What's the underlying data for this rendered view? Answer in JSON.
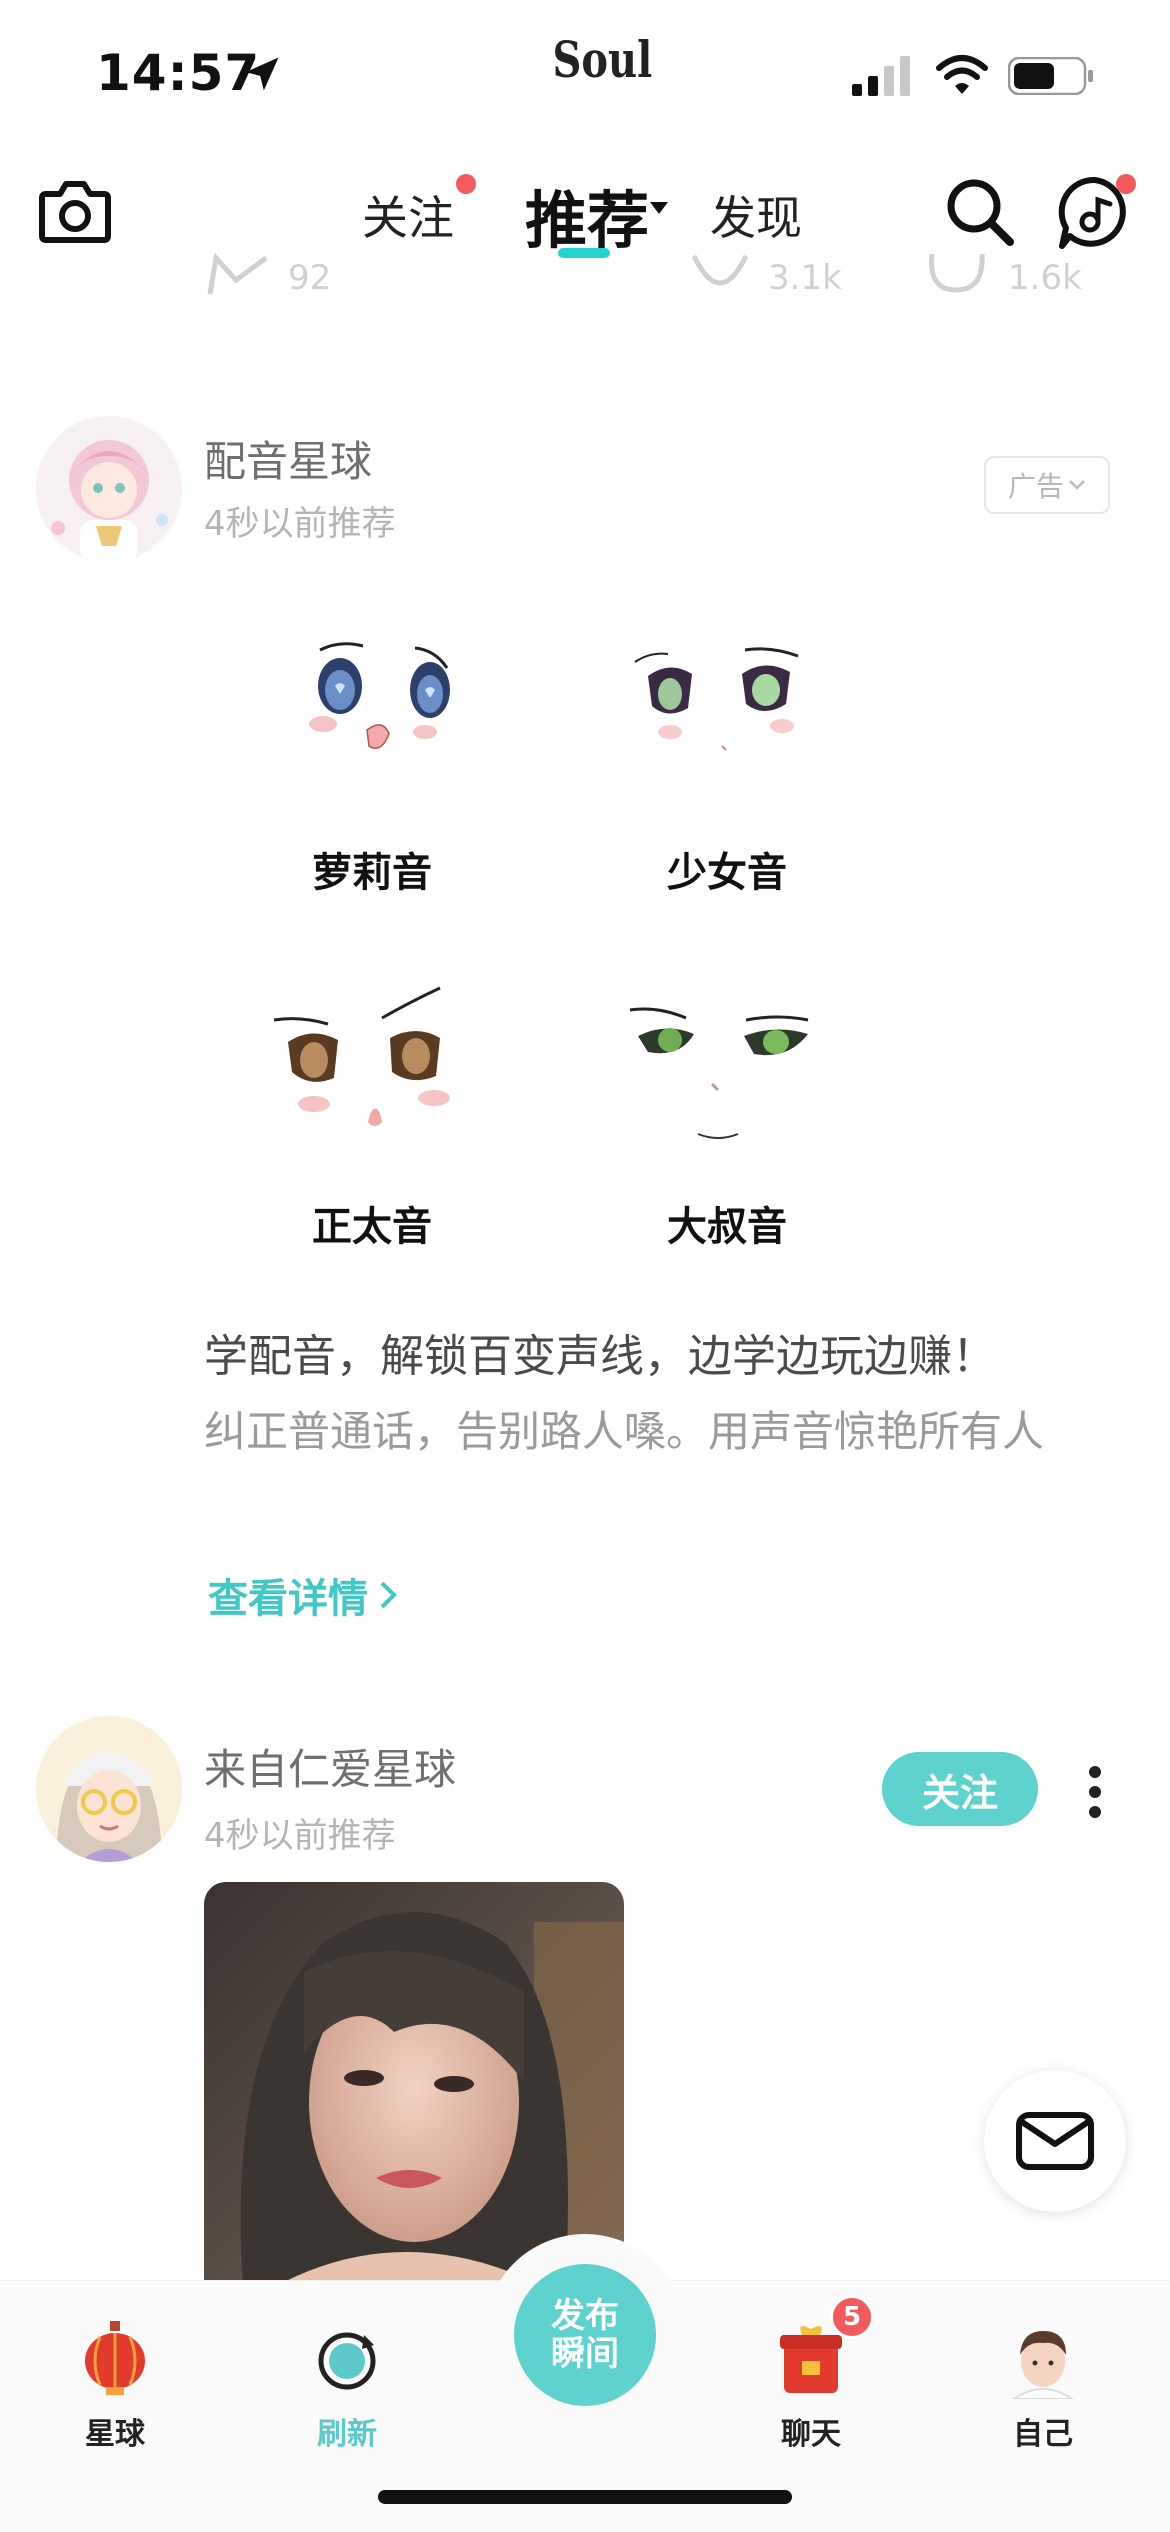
{
  "status_bar": {
    "time": "14:57",
    "carrier": "Soul"
  },
  "nav": {
    "tabs": [
      {
        "label": "关注",
        "has_dot": true
      },
      {
        "label": "推荐",
        "active": true
      },
      {
        "label": "发现"
      }
    ],
    "accent_color": "#25d4d0"
  },
  "previous_post": {
    "stat_1": "92",
    "stat_2": "3.1k",
    "stat_3": "1.6k"
  },
  "ad_post": {
    "author": "配音星球",
    "time": "4秒以前推荐",
    "tag": "广告",
    "voices": [
      "萝莉音",
      "少女音",
      "正太音",
      "大叔音"
    ],
    "headline": "学配音，解锁百变声线，边学边玩边赚！",
    "body": "纠正普通话，告别路人嗓。用声音惊艳所有人",
    "link": "查看详情"
  },
  "post2": {
    "author": "来自仁爱星球",
    "time": "4秒以前推荐",
    "follow_label": "关注"
  },
  "tab_bar": {
    "items": [
      {
        "label": "星球",
        "icon": "lantern-icon"
      },
      {
        "label": "刷新",
        "icon": "refresh-icon",
        "active": true
      },
      {
        "label": "聊天",
        "icon": "chat-gift-icon",
        "badge": "5"
      },
      {
        "label": "自己",
        "icon": "self-avatar-icon"
      }
    ],
    "publish_label": "发布瞬间"
  }
}
